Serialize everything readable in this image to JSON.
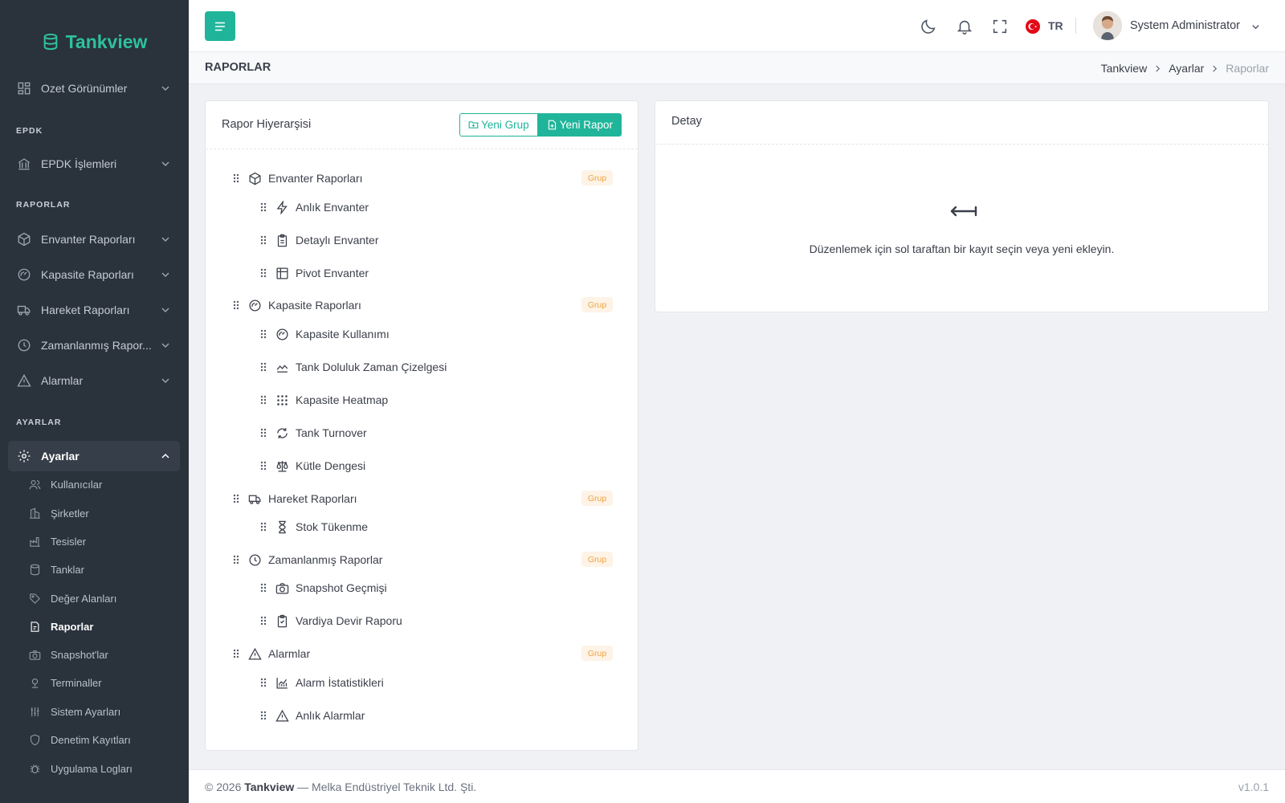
{
  "brand": {
    "name": "Tankview",
    "color": "#2ec19e"
  },
  "accent_color": "#20b59a",
  "sidebar": {
    "top_items": [
      {
        "label": "Ozet Görünümler",
        "icon": "dashboard-icon"
      }
    ],
    "sections": [
      {
        "title": "EPDK",
        "items": [
          {
            "label": "EPDK İşlemleri",
            "icon": "bank-icon"
          }
        ]
      },
      {
        "title": "RAPORLAR",
        "items": [
          {
            "label": "Envanter Raporları",
            "icon": "box-icon"
          },
          {
            "label": "Kapasite Raporları",
            "icon": "gauge-icon"
          },
          {
            "label": "Hareket Raporları",
            "icon": "truck-icon"
          },
          {
            "label": "Zamanlanmış Rapor...",
            "icon": "clock-icon"
          },
          {
            "label": "Alarmlar",
            "icon": "alert-icon"
          }
        ]
      },
      {
        "title": "AYARLAR",
        "items": [
          {
            "label": "Ayarlar",
            "icon": "gear-icon",
            "expanded": true
          }
        ]
      }
    ],
    "settings_sub": [
      {
        "label": "Kullanıcılar",
        "icon": "users-icon"
      },
      {
        "label": "Şirketler",
        "icon": "building-icon"
      },
      {
        "label": "Tesisler",
        "icon": "factory-icon"
      },
      {
        "label": "Tanklar",
        "icon": "database-icon"
      },
      {
        "label": "Değer Alanları",
        "icon": "tag-icon"
      },
      {
        "label": "Raporlar",
        "icon": "report-icon",
        "active": true
      },
      {
        "label": "Snapshot'lar",
        "icon": "camera-icon"
      },
      {
        "label": "Terminaller",
        "icon": "terminal-icon"
      },
      {
        "label": "Sistem Ayarları",
        "icon": "sliders-icon"
      },
      {
        "label": "Denetim Kayıtları",
        "icon": "shield-icon"
      },
      {
        "label": "Uygulama Logları",
        "icon": "bug-icon"
      }
    ]
  },
  "topbar": {
    "language": "TR",
    "user_name": "System Administrator"
  },
  "subheader": {
    "title": "RAPORLAR",
    "breadcrumbs": [
      "Tankview",
      "Ayarlar",
      "Raporlar"
    ]
  },
  "left_panel": {
    "title": "Rapor Hiyerarşisi",
    "new_group_label": "Yeni Grup",
    "new_report_label": "Yeni Rapor",
    "badge_label": "Grup",
    "groups": [
      {
        "label": "Envanter Raporları",
        "icon": "box-icon",
        "children": [
          {
            "label": "Anlık Envanter",
            "icon": "bolt-icon"
          },
          {
            "label": "Detaylı Envanter",
            "icon": "clipboard-icon"
          },
          {
            "label": "Pivot Envanter",
            "icon": "table-icon"
          }
        ]
      },
      {
        "label": "Kapasite Raporları",
        "icon": "gauge-icon",
        "children": [
          {
            "label": "Kapasite Kullanımı",
            "icon": "gauge-icon"
          },
          {
            "label": "Tank Doluluk Zaman Çizelgesi",
            "icon": "area-chart-icon"
          },
          {
            "label": "Kapasite Heatmap",
            "icon": "grid-dots-icon"
          },
          {
            "label": "Tank Turnover",
            "icon": "refresh-icon"
          },
          {
            "label": "Kütle Dengesi",
            "icon": "scale-icon"
          }
        ]
      },
      {
        "label": "Hareket Raporları",
        "icon": "truck-icon",
        "children": [
          {
            "label": "Stok Tükenme",
            "icon": "hourglass-icon"
          }
        ]
      },
      {
        "label": "Zamanlanmış Raporlar",
        "icon": "clock-icon",
        "children": [
          {
            "label": "Snapshot Geçmişi",
            "icon": "camera-icon"
          },
          {
            "label": "Vardiya Devir Raporu",
            "icon": "clipboard-check-icon"
          }
        ]
      },
      {
        "label": "Alarmlar",
        "icon": "alert-icon",
        "children": [
          {
            "label": "Alarm İstatistikleri",
            "icon": "stats-icon"
          },
          {
            "label": "Anlık Alarmlar",
            "icon": "alert-icon"
          }
        ]
      }
    ]
  },
  "right_panel": {
    "title": "Detay",
    "empty_message": "Düzenlemek için sol taraftan bir kayıt seçin veya yeni ekleyin."
  },
  "footer": {
    "copyright": "© 2026",
    "brand": "Tankview",
    "company": "— Melka Endüstriyel Teknik Ltd. Şti.",
    "version": "v1.0.1"
  }
}
